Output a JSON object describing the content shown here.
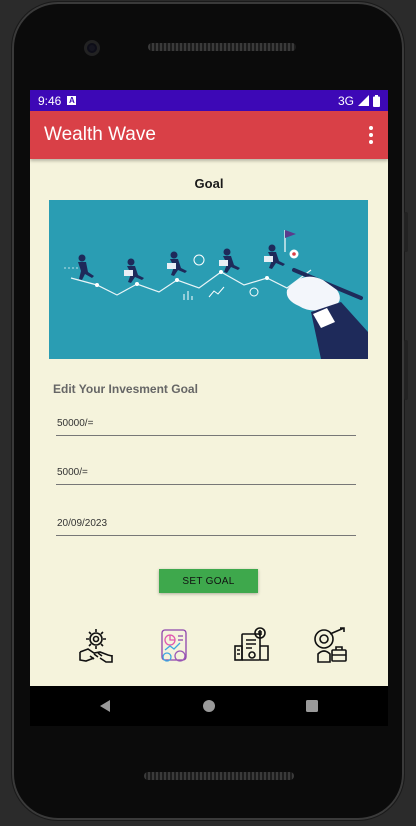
{
  "status_bar": {
    "time": "9:46",
    "notification_badge": "A",
    "network": "3G"
  },
  "app_bar": {
    "title": "Wealth Wave",
    "menu_icon": "more-vert-icon"
  },
  "page": {
    "title": "Goal",
    "banner_icon": "goal-race-illustration"
  },
  "form": {
    "section_label": "Edit Your Invesment Goal",
    "goal_amount": "50000/=",
    "monthly_amount": "5000/=",
    "target_date": "20/09/2023",
    "submit_label": "SET GOAL"
  },
  "bottom_nav": [
    {
      "icon": "gear-handshake-icon"
    },
    {
      "icon": "investment-report-icon"
    },
    {
      "icon": "financial-document-icon"
    },
    {
      "icon": "business-analysis-icon"
    }
  ],
  "system_nav": {
    "back": "back-triangle-icon",
    "home": "home-circle-icon",
    "recents": "recents-square-icon"
  },
  "colors": {
    "status_bar": "#3d08b6",
    "app_bar": "#d94047",
    "background": "#f5f3dc",
    "banner": "#2a9db3",
    "button": "#3ea84c"
  }
}
